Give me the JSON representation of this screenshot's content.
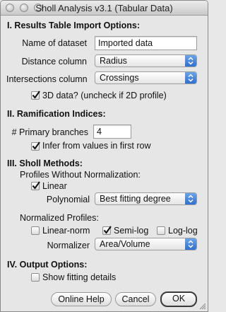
{
  "window": {
    "title": "Sholl Analysis v3.1 (Tabular Data)"
  },
  "section1": {
    "heading": "I. Results Table Import Options:",
    "dataset_label": "Name of dataset",
    "dataset_value": "Imported data",
    "distance_label": "Distance column",
    "distance_value": "Radius",
    "intersections_label": "Intersections column",
    "intersections_value": "Crossings",
    "threed_label": "3D data? (uncheck if 2D profile)",
    "threed_checked": true
  },
  "section2": {
    "heading": "II. Ramification Indices:",
    "primary_label": "# Primary branches",
    "primary_value": "4",
    "infer_label": "Infer from values in first row",
    "infer_checked": true
  },
  "section3": {
    "heading": "III. Sholl Methods:",
    "profiles_heading": "Profiles Without Normalization:",
    "linear_label": "Linear",
    "linear_checked": true,
    "polynomial_label": "Polynomial",
    "polynomial_value": "Best fitting degree",
    "normalized_heading": "Normalized Profiles:",
    "linear_norm_label": "Linear-norm",
    "linear_norm_checked": false,
    "semilog_label": "Semi-log",
    "semilog_checked": true,
    "loglog_label": "Log-log",
    "loglog_checked": false,
    "normalizer_label": "Normalizer",
    "normalizer_value": "Area/Volume"
  },
  "section4": {
    "heading": "IV. Output Options:",
    "show_fitting_label": "Show fitting details",
    "show_fitting_checked": false
  },
  "buttons": {
    "help": "Online Help",
    "cancel": "Cancel",
    "ok": "OK"
  },
  "icons": {
    "checkmark": "checkmark-icon",
    "dropdown": "chevron-updown-icon",
    "close": "close-dot-icon",
    "minimize": "minimize-dot-icon",
    "zoom": "zoom-dot-icon",
    "resize": "resize-grip-icon"
  },
  "colors": {
    "accent_blue": "#2f6fcf",
    "window_bg": "#e6e6e6"
  }
}
